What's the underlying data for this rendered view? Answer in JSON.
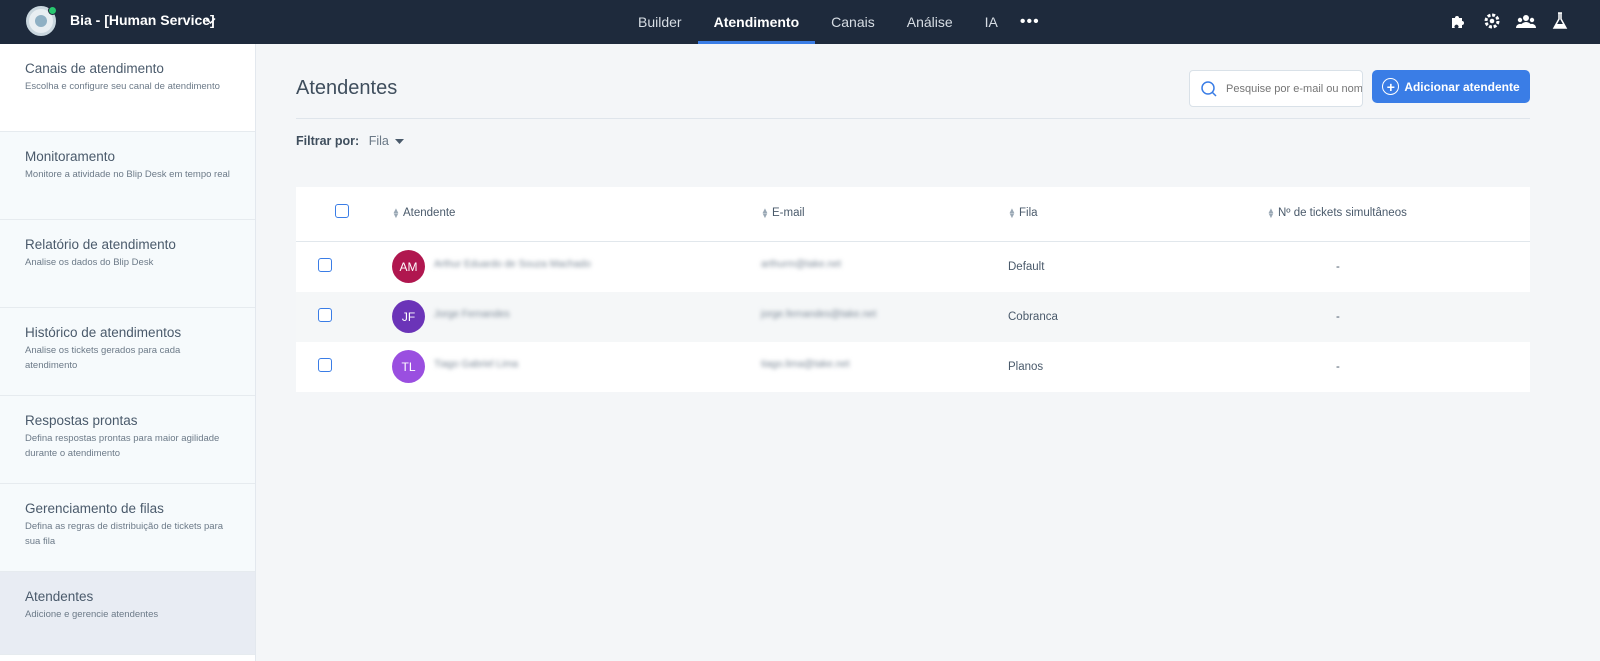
{
  "header": {
    "bot_name": "Bia - [Human Service]",
    "nav": [
      {
        "label": "Builder",
        "active": false
      },
      {
        "label": "Atendimento",
        "active": true
      },
      {
        "label": "Canais",
        "active": false
      },
      {
        "label": "Análise",
        "active": false
      },
      {
        "label": "IA",
        "active": false
      }
    ],
    "more_label": "•••",
    "icons": [
      "puzzle-icon",
      "gear-icon",
      "team-icon",
      "flask-icon"
    ]
  },
  "sidebar": {
    "items": [
      {
        "title": "Canais de atendimento",
        "desc": "Escolha e configure seu canal de atendimento"
      },
      {
        "title": "Monitoramento",
        "desc": "Monitore a atividade no Blip Desk em tempo real"
      },
      {
        "title": "Relatório de atendimento",
        "desc": "Analise os dados do Blip Desk"
      },
      {
        "title": "Histórico de atendimentos",
        "desc": "Analise os tickets gerados para cada atendimento"
      },
      {
        "title": "Respostas prontas",
        "desc": "Defina respostas prontas para maior agilidade durante o atendimento"
      },
      {
        "title": "Gerenciamento de filas",
        "desc": "Defina as regras de distribuição de tickets para sua fila"
      },
      {
        "title": "Atendentes",
        "desc": "Adicione e gerencie atendentes"
      }
    ]
  },
  "main": {
    "title": "Atendentes",
    "search_placeholder": "Pesquise por e-mail ou nome",
    "add_button": "Adicionar atendente",
    "filter_label": "Filtrar por:",
    "filter_value": "Fila"
  },
  "table": {
    "columns": {
      "name": "Atendente",
      "email": "E-mail",
      "queue": "Fila",
      "tickets": "Nº de tickets simultâneos"
    },
    "rows": [
      {
        "initials": "AM",
        "color": "#b0174f",
        "name": "Arthur Eduardo de Souza Machado",
        "email": "arthurm@take.net",
        "queue": "Default",
        "tickets": "-"
      },
      {
        "initials": "JF",
        "color": "#6b34b8",
        "name": "Jorge Fernandes",
        "email": "jorge.fernandes@take.net",
        "queue": "Cobranca",
        "tickets": "-"
      },
      {
        "initials": "TL",
        "color": "#9a4fe0",
        "name": "Tiago Gabriel Lima",
        "email": "tiago.lima@take.net",
        "queue": "Planos",
        "tickets": "-"
      }
    ]
  }
}
